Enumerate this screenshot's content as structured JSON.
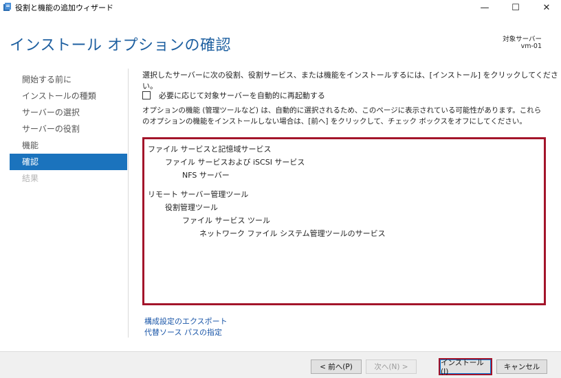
{
  "window": {
    "title": "役割と機能の追加ウィザード",
    "minimize": "—",
    "maximize": "☐",
    "close": "✕"
  },
  "header": {
    "page_title": "インストール オプションの確認",
    "target_label": "対象サーバー",
    "target_value": "vm-01"
  },
  "sidebar": {
    "items": [
      {
        "label": "開始する前に",
        "state": "normal"
      },
      {
        "label": "インストールの種類",
        "state": "normal"
      },
      {
        "label": "サーバーの選択",
        "state": "normal"
      },
      {
        "label": "サーバーの役割",
        "state": "normal"
      },
      {
        "label": "機能",
        "state": "normal"
      },
      {
        "label": "確認",
        "state": "active"
      },
      {
        "label": "結果",
        "state": "disabled"
      }
    ]
  },
  "main": {
    "intro": "選択したサーバーに次の役割、役割サービス、または機能をインストールするには、[インストール] をクリックしてください。",
    "restart_label": "必要に応じて対象サーバーを自動的に再起動する",
    "restart_checked": false,
    "note": "オプションの機能 (管理ツールなど) は、自動的に選択されるため、このページに表示されている可能性があります。これらのオプションの機能をインストールしない場合は、[前へ] をクリックして、チェック ボックスをオフにしてください。",
    "features": [
      {
        "label": "ファイル サービスと記憶域サービス",
        "level": 0
      },
      {
        "label": "ファイル サービスおよび iSCSI サービス",
        "level": 1
      },
      {
        "label": "NFS サーバー",
        "level": 2
      },
      {
        "label": "リモート サーバー管理ツール",
        "level": 0
      },
      {
        "label": "役割管理ツール",
        "level": 1
      },
      {
        "label": "ファイル サービス ツール",
        "level": 2
      },
      {
        "label": "ネットワーク ファイル システム管理ツールのサービス",
        "level": 3
      }
    ],
    "links": {
      "export": "構成設定のエクスポート",
      "alt_source": "代替ソース パスの指定"
    }
  },
  "footer": {
    "prev": "< 前へ(P)",
    "next": "次へ(N) >",
    "install": "インストール(I)",
    "cancel": "キャンセル"
  },
  "colors": {
    "accent": "#1b73bd",
    "title": "#1d5fa0",
    "highlight": "#a3142a",
    "link": "#1a56a8"
  }
}
